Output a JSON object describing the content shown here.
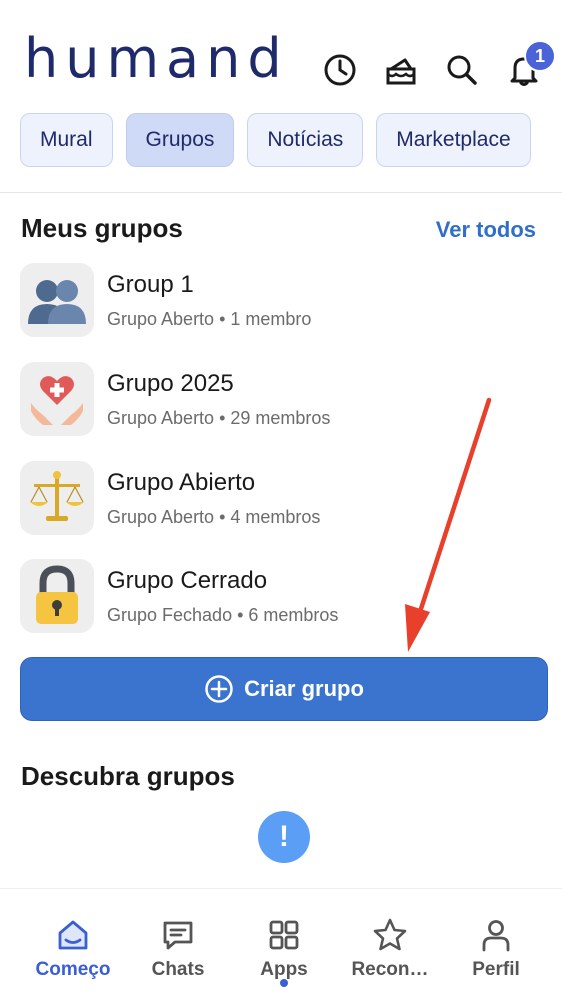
{
  "header": {
    "logo_text": "humand",
    "notification_count": "1",
    "icons": [
      "history-icon",
      "birthday-cake-icon",
      "search-icon",
      "bell-icon"
    ]
  },
  "tabs": [
    {
      "label": "Mural",
      "active": false
    },
    {
      "label": "Grupos",
      "active": true
    },
    {
      "label": "Notícias",
      "active": false
    },
    {
      "label": "Marketplace",
      "active": false
    }
  ],
  "my_groups": {
    "title": "Meus grupos",
    "see_all": "Ver todos",
    "items": [
      {
        "name": "Group 1",
        "meta": "Grupo Aberto • 1 membro",
        "icon": "people-icon"
      },
      {
        "name": "Grupo 2025",
        "meta": "Grupo Aberto • 29 membros",
        "icon": "heart-hands-icon"
      },
      {
        "name": "Grupo Abierto",
        "meta": "Grupo Aberto • 4 membros",
        "icon": "scales-icon"
      },
      {
        "name": "Grupo Cerrado",
        "meta": "Grupo Fechado • 6 membros",
        "icon": "padlock-icon"
      }
    ],
    "create_label": "Criar grupo"
  },
  "discover": {
    "title": "Descubra grupos"
  },
  "bottom_nav": [
    {
      "label": "Começo",
      "icon": "home-icon",
      "active": true
    },
    {
      "label": "Chats",
      "icon": "chat-icon",
      "active": false
    },
    {
      "label": "Apps",
      "icon": "apps-grid-icon",
      "active": false
    },
    {
      "label": "Recon…",
      "icon": "star-icon",
      "active": false
    },
    {
      "label": "Perfil",
      "icon": "profile-icon",
      "active": false
    }
  ],
  "colors": {
    "brand": "#1f2a6b",
    "accent": "#3a74cf",
    "link": "#2f6fcb",
    "badge": "#4a63d6",
    "annotation_arrow": "#e8402a"
  }
}
